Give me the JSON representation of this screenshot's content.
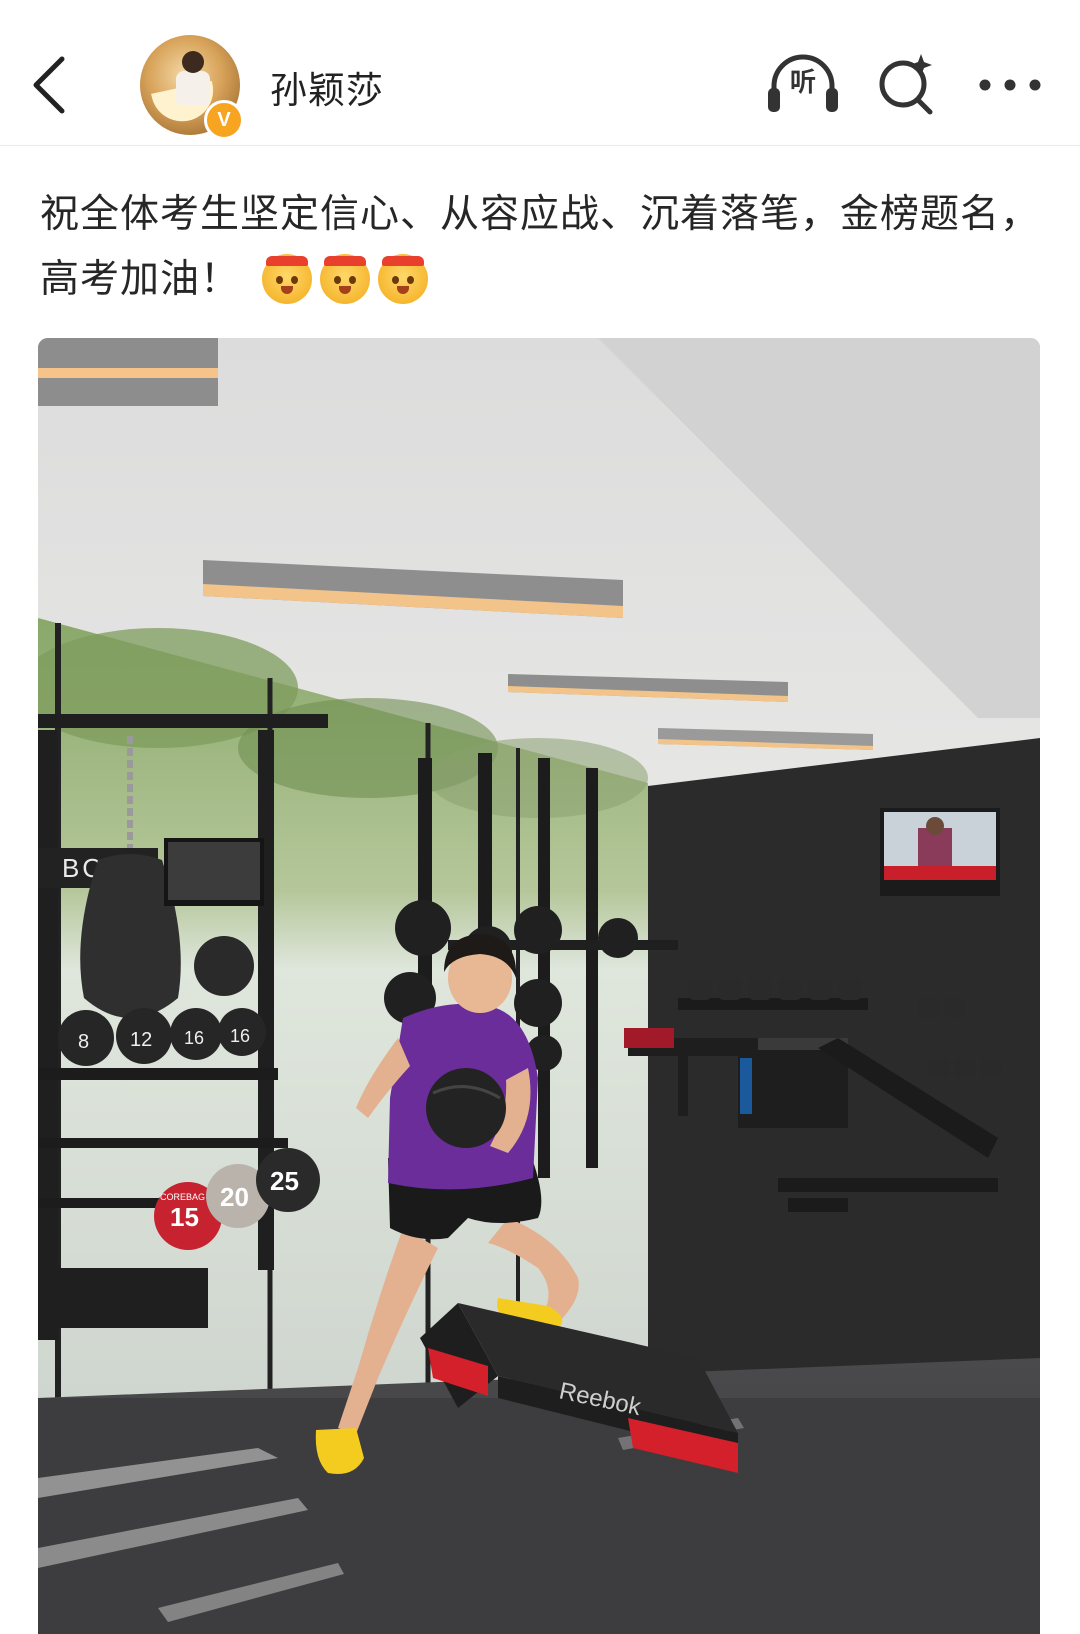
{
  "header": {
    "username": "孙颖莎",
    "verified_badge": "V",
    "listen_label": "听",
    "icons": {
      "back": "back-arrow-icon",
      "listen": "headphones-icon",
      "search": "search-sparkle-icon",
      "more": "more-dots-icon"
    }
  },
  "post": {
    "text": "祝全体考生坚定信心、从容应战、沉着落笔，金榜题名，高考加油！",
    "emoji_count": 3,
    "emoji_icon": "cheer-headband-emoji"
  },
  "photo": {
    "box_brand": "Reebok",
    "wall_logo": "BOXR",
    "kettlebells": [
      "8",
      "12",
      "16",
      "16"
    ],
    "plates": [
      "15",
      "20",
      "25"
    ],
    "plate_brand": "COREBAG",
    "colors": {
      "shirt": "#6a2d9a",
      "shoes": "#f4cc1f",
      "step_red": "#d4202a"
    }
  }
}
